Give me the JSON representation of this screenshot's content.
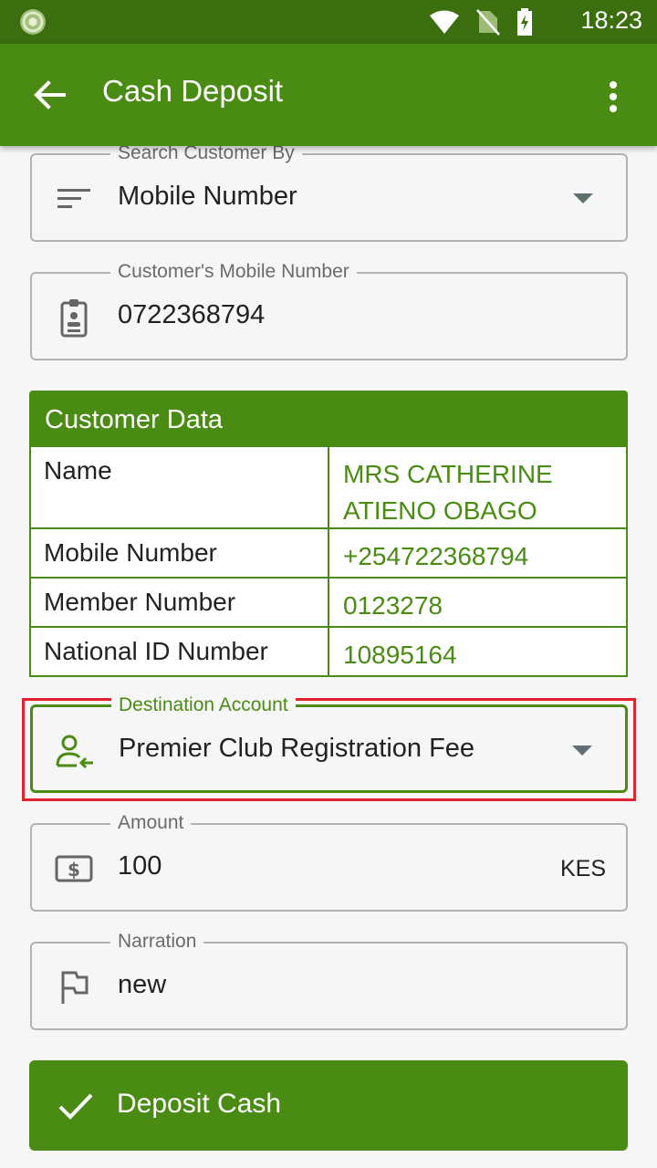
{
  "status": {
    "time": "18:23"
  },
  "appbar": {
    "title": "Cash Deposit"
  },
  "form": {
    "search_by": {
      "label": "Search Customer By",
      "value": "Mobile Number"
    },
    "mobile": {
      "label": "Customer's Mobile Number",
      "value": "0722368794"
    },
    "destination": {
      "label": "Destination Account",
      "value": "Premier Club Registration Fee"
    },
    "amount": {
      "label": "Amount",
      "value": "100",
      "currency": "KES"
    },
    "narration": {
      "label": "Narration",
      "value": "new"
    }
  },
  "customer": {
    "title": "Customer Data",
    "rows": [
      {
        "key": "Name",
        "value": "MRS CATHERINE ATIENO OBAGO"
      },
      {
        "key": "Mobile Number",
        "value": "+254722368794"
      },
      {
        "key": "Member Number",
        "value": "0123278"
      },
      {
        "key": "National ID Number",
        "value": "10895164"
      }
    ]
  },
  "action": {
    "label": "Deposit Cash"
  },
  "colors": {
    "primary": "#4a8c13",
    "statusbar": "#3a6e0f",
    "highlight": "#e0232e"
  }
}
